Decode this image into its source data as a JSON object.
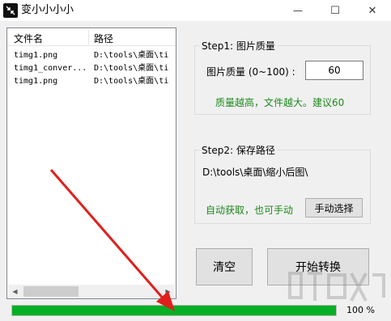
{
  "window": {
    "title": "变小小小小",
    "controls": {
      "minimize": "—",
      "maximize": "☐",
      "close": "✕"
    }
  },
  "file_list": {
    "columns": [
      "文件名",
      "路径"
    ],
    "rows": [
      {
        "name": "timg1.png",
        "path": "D:\\tools\\桌面\\ti"
      },
      {
        "name": "timg1_conver...",
        "path": "D:\\tools\\桌面\\ti"
      },
      {
        "name": "timg1.png",
        "path": "D:\\tools\\桌面\\ti"
      }
    ],
    "scroll_left_arrow": "◀",
    "scroll_right_arrow": "▶"
  },
  "step1": {
    "title": "Step1: 图片质量",
    "label": "图片质量 (0~100) :",
    "value": "60",
    "hint": "质量越高，文件越大。建议60"
  },
  "step2": {
    "title": "Step2: 保存路径",
    "path": "D:\\tools\\桌面\\缩小后图\\",
    "hint": "自动获取，也可手动",
    "manual_button": "手动选择"
  },
  "actions": {
    "clear_button": "清空",
    "start_button": "开始转换"
  },
  "progress": {
    "value": 100,
    "label": "100 %"
  },
  "colors": {
    "progress_fill": "#06b025",
    "hint_green": "#1d8a1d",
    "annotation_arrow": "#e0201c"
  }
}
